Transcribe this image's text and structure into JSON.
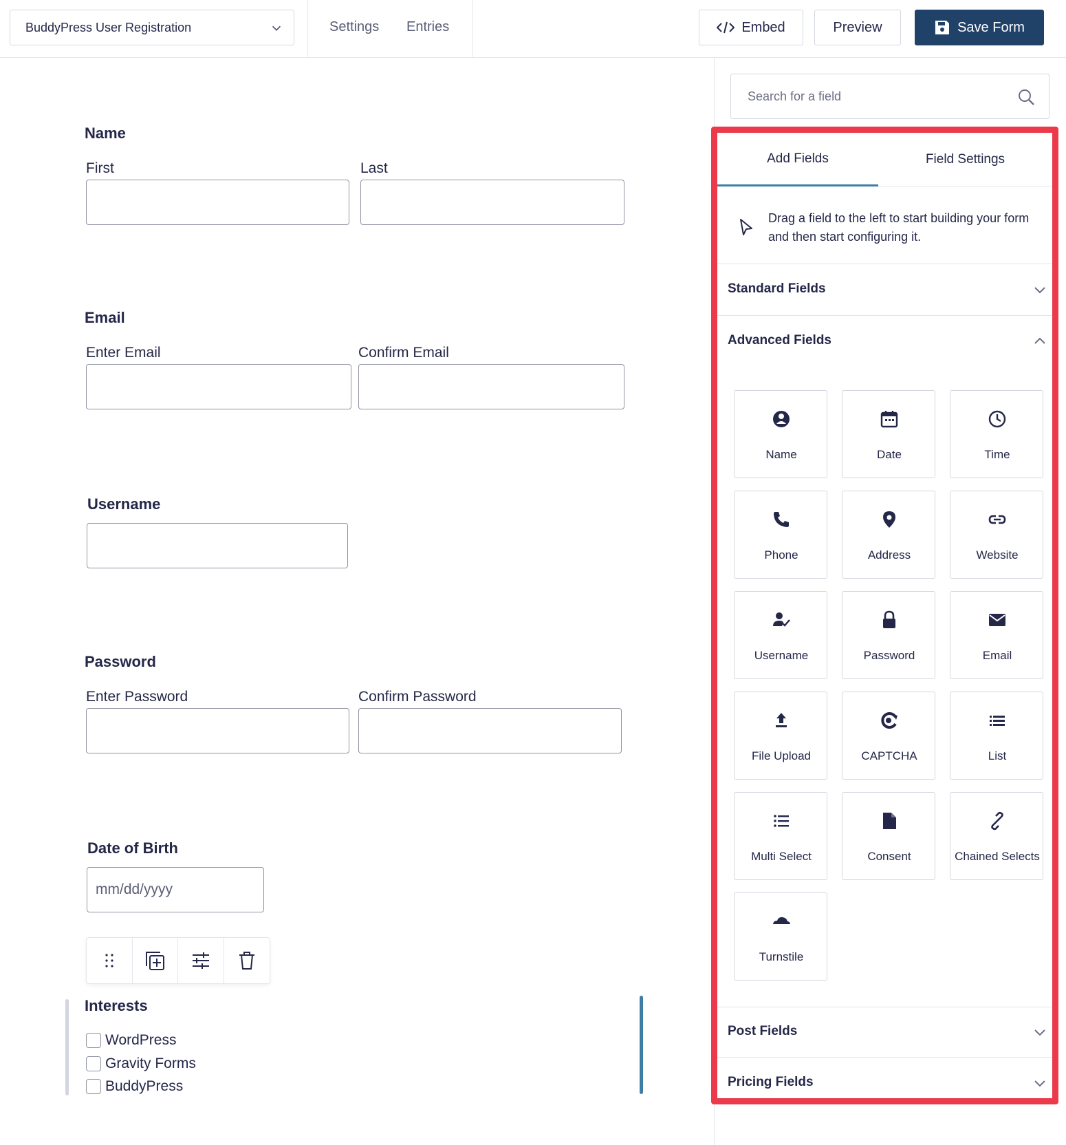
{
  "header": {
    "form_selector_value": "BuddyPress User Registration",
    "links": {
      "settings": "Settings",
      "entries": "Entries"
    },
    "buttons": {
      "embed": "Embed",
      "preview": "Preview",
      "save": "Save Form"
    }
  },
  "form": {
    "name": {
      "title": "Name",
      "first_label": "First",
      "last_label": "Last"
    },
    "email": {
      "title": "Email",
      "enter_label": "Enter Email",
      "confirm_label": "Confirm Email"
    },
    "username": {
      "title": "Username"
    },
    "password": {
      "title": "Password",
      "enter_label": "Enter Password",
      "confirm_label": "Confirm Password"
    },
    "dob": {
      "title": "Date of Birth",
      "placeholder": "mm/dd/yyyy"
    },
    "interests": {
      "title": "Interests",
      "options": [
        "WordPress",
        "Gravity Forms",
        "BuddyPress"
      ]
    },
    "field_toolbar": [
      "drag-handle-icon",
      "duplicate-icon",
      "settings-sliders-icon",
      "trash-icon"
    ]
  },
  "sidebar": {
    "search_placeholder": "Search for a field",
    "tabs": {
      "add_fields": "Add Fields",
      "field_settings": "Field Settings"
    },
    "hint": "Drag a field to the left to start building your form and then start configuring it.",
    "sections": {
      "standard": "Standard Fields",
      "advanced": "Advanced Fields",
      "post": "Post Fields",
      "pricing": "Pricing Fields"
    },
    "advanced_fields": [
      {
        "label": "Name",
        "icon": "user-circle-icon"
      },
      {
        "label": "Date",
        "icon": "calendar-icon"
      },
      {
        "label": "Time",
        "icon": "clock-icon"
      },
      {
        "label": "Phone",
        "icon": "phone-icon"
      },
      {
        "label": "Address",
        "icon": "map-pin-icon"
      },
      {
        "label": "Website",
        "icon": "link-icon"
      },
      {
        "label": "Username",
        "icon": "user-check-icon"
      },
      {
        "label": "Password",
        "icon": "lock-icon"
      },
      {
        "label": "Email",
        "icon": "envelope-icon"
      },
      {
        "label": "File Upload",
        "icon": "upload-icon"
      },
      {
        "label": "CAPTCHA",
        "icon": "captcha-icon"
      },
      {
        "label": "List",
        "icon": "list-icon"
      },
      {
        "label": "Multi Select",
        "icon": "multi-select-icon"
      },
      {
        "label": "Consent",
        "icon": "document-icon"
      },
      {
        "label": "Chained Selects",
        "icon": "chain-icon"
      },
      {
        "label": "Turnstile",
        "icon": "cloud-icon"
      }
    ],
    "colors": {
      "highlight_border": "#ea3a4b",
      "accent": "#3e7da6",
      "primary_button": "#204269"
    }
  }
}
